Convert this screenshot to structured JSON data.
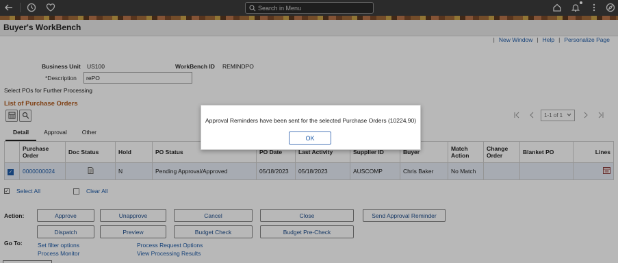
{
  "topbar": {
    "search_placeholder": "Search in Menu",
    "icons": [
      "back-arrow-icon",
      "history-icon",
      "heart-icon",
      "home-icon",
      "bell-icon",
      "more-vertical-icon",
      "compass-icon"
    ]
  },
  "header": {
    "title": "Buyer's WorkBench",
    "links": [
      "New Window",
      "Help",
      "Personalize Page"
    ]
  },
  "form": {
    "business_unit_label": "Business Unit",
    "business_unit_value": "US100",
    "workbench_id_label": "WorkBench ID",
    "workbench_id_value": "REMINDPO",
    "description_label": "*Description",
    "description_value": "rePO",
    "subtitle": "Select POs for Further Processing",
    "section_title": "List of Purchase Orders"
  },
  "grid": {
    "pager_text": "1-1 of 1",
    "tabs": [
      "Detail",
      "Approval",
      "Other"
    ],
    "columns": [
      "Purchase Order",
      "Doc Status",
      "Hold",
      "PO Status",
      "PO Date",
      "Last Activity",
      "Supplier ID",
      "Buyer",
      "Match Action",
      "Change Order",
      "Blanket PO",
      "Lines"
    ],
    "rows": [
      {
        "purchase_order": "0000000024",
        "hold": "N",
        "po_status": "Pending Approval/Approved",
        "po_date": "05/18/2023",
        "last_activity": "05/18/2023",
        "supplier_id": "AUSCOMP",
        "buyer": "Chris Baker",
        "match_action": "No Match"
      }
    ]
  },
  "selection": {
    "select_all": "Select All",
    "clear_all": "Clear All"
  },
  "actions": {
    "label": "Action:",
    "approve": "Approve",
    "unapprove": "Unapprove",
    "cancel": "Cancel",
    "close": "Close",
    "send_reminder": "Send Approval Reminder",
    "dispatch": "Dispatch",
    "preview": "Preview",
    "budget_check": "Budget Check",
    "budget_precheck": "Budget Pre-Check"
  },
  "goto": {
    "label": "Go To:",
    "set_filter": "Set filter options",
    "process_request": "Process Request Options",
    "process_monitor": "Process Monitor",
    "view_results": "View Processing Results"
  },
  "modal": {
    "message": "Approval Reminders have been sent for the selected Purchase Orders (10224,90)",
    "ok_label": "OK"
  },
  "colors": {
    "topbar": "#3c3c3c",
    "link": "#1f5ca8",
    "section_title": "#b05a1e"
  }
}
